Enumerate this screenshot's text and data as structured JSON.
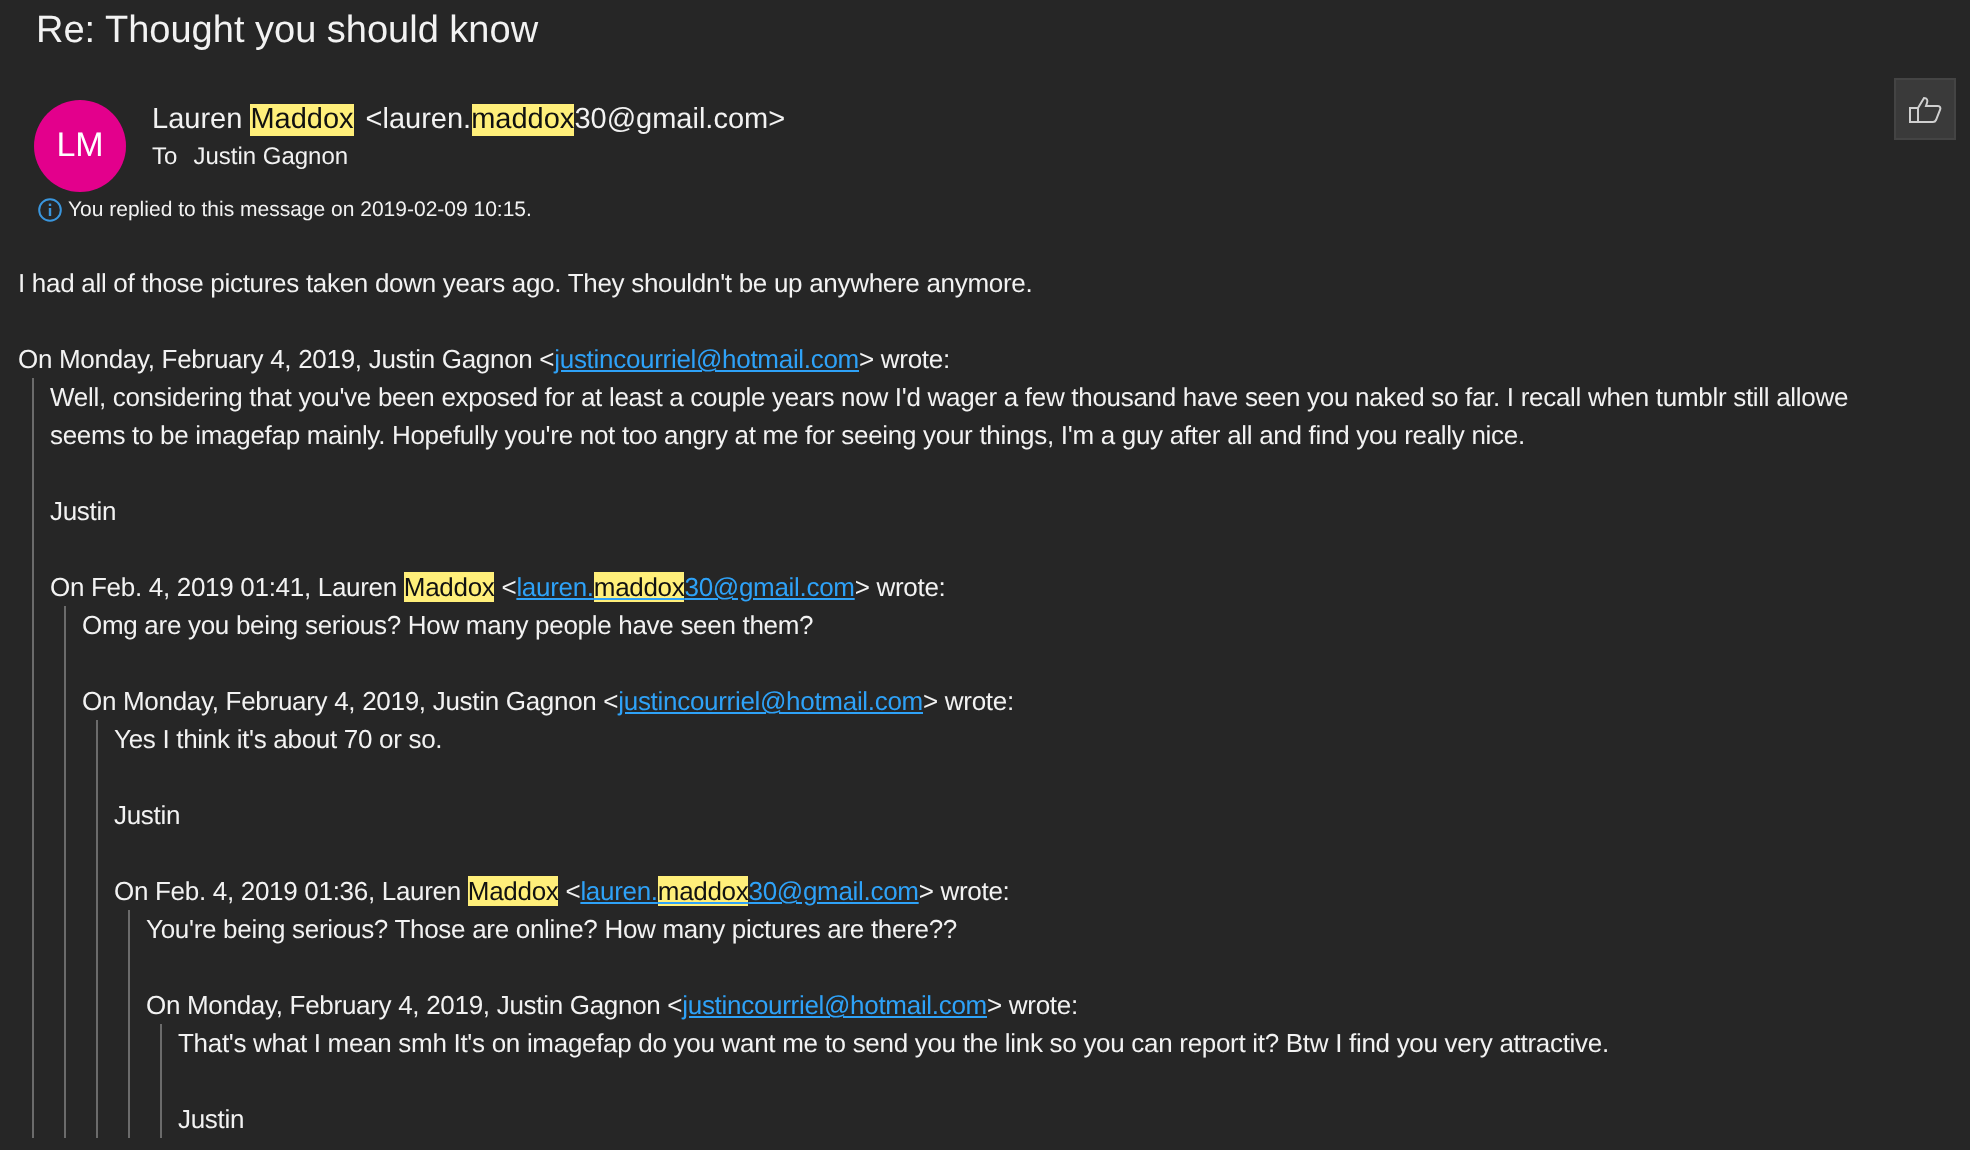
{
  "title": "Re: Thought you should know",
  "sender": {
    "initials": "LM",
    "name_parts": [
      {
        "text": "Lauren ",
        "highlighted": false
      },
      {
        "text": "Maddox",
        "highlighted": true
      }
    ],
    "address_parts": [
      {
        "text": "<lauren.",
        "highlighted": false
      },
      {
        "text": "maddox",
        "highlighted": true
      },
      {
        "text": "30@gmail.com>",
        "highlighted": false
      }
    ],
    "to_label": "To",
    "recipient": "Justin Gagnon"
  },
  "reply_notice": "You replied to this message on 2019-02-09 10:15.",
  "body": [
    "I had all of those pictures taken down years ago. They shouldn't be up anywhere anymore."
  ],
  "quote": {
    "before": [
      {
        "text": "On Monday, February 4, 2019, Justin Gagnon <",
        "highlighted": false
      }
    ],
    "link": [
      {
        "text": "justincourriel@hotmail.com",
        "highlighted": false
      }
    ],
    "after": "> wrote:",
    "paragraphs": [
      [
        "Well, considering that you've been exposed for at least a couple years now I'd wager a few thousand have seen you naked so far. I recall when tumblr still allowe",
        "seems to be imagefap mainly. Hopefully you're not too angry at me for seeing your things, I'm a guy after all and find you really nice."
      ],
      [
        "Justin"
      ]
    ],
    "quote": {
      "before": [
        {
          "text": "On Feb. 4, 2019 01:41, Lauren ",
          "highlighted": false
        },
        {
          "text": "Maddox",
          "highlighted": true
        },
        {
          "text": " <",
          "highlighted": false
        }
      ],
      "link": [
        {
          "text": "lauren.",
          "highlighted": false
        },
        {
          "text": "maddox",
          "highlighted": true
        },
        {
          "text": "30@gmail.com",
          "highlighted": false
        }
      ],
      "after": "> wrote:",
      "paragraphs": [
        [
          "Omg are you being serious? How many people have seen them?"
        ]
      ],
      "quote": {
        "before": [
          {
            "text": "On Monday, February 4, 2019, Justin Gagnon <",
            "highlighted": false
          }
        ],
        "link": [
          {
            "text": "justincourriel@hotmail.com",
            "highlighted": false
          }
        ],
        "after": "> wrote:",
        "paragraphs": [
          [
            "Yes I think it's about 70 or so."
          ],
          [
            "Justin"
          ]
        ],
        "quote": {
          "before": [
            {
              "text": "On Feb. 4, 2019 01:36, Lauren ",
              "highlighted": false
            },
            {
              "text": "Maddox",
              "highlighted": true
            },
            {
              "text": " <",
              "highlighted": false
            }
          ],
          "link": [
            {
              "text": "lauren.",
              "highlighted": false
            },
            {
              "text": "maddox",
              "highlighted": true
            },
            {
              "text": "30@gmail.com",
              "highlighted": false
            }
          ],
          "after": "> wrote:",
          "paragraphs": [
            [
              "You're being serious? Those are online? How many pictures are there??"
            ]
          ],
          "quote": {
            "before": [
              {
                "text": "On Monday, February 4, 2019, Justin Gagnon <",
                "highlighted": false
              }
            ],
            "link": [
              {
                "text": "justincourriel@hotmail.com",
                "highlighted": false
              }
            ],
            "after": "> wrote:",
            "paragraphs": [
              [
                "That's what I mean smh It's on imagefap do you want me to send you the link so you can report it? Btw I find you very attractive."
              ],
              [
                "Justin"
              ]
            ]
          }
        }
      }
    }
  }
}
